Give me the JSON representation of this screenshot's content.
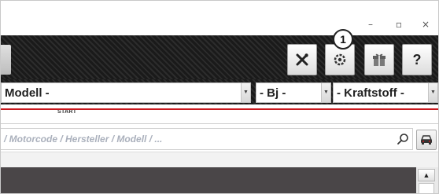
{
  "window": {
    "minimize_glyph": "–",
    "maximize_glyph": "▫",
    "close_glyph": "×"
  },
  "toolbar": {
    "buttons": [
      {
        "name": "tools-button",
        "icon": "wrench-screwdriver-icon"
      },
      {
        "name": "settings-button",
        "icon": "cog-refresh-icon"
      },
      {
        "name": "gift-button",
        "icon": "gift-icon"
      },
      {
        "name": "help-button",
        "icon": "question-icon",
        "label": "?"
      }
    ],
    "callout_number": "1"
  },
  "selectors": {
    "model": "Modell -",
    "year": "- Bj -",
    "fuel": "- Kraftstoff -"
  },
  "tabs": {
    "start_label": "START",
    "accent_color": "#c8191e"
  },
  "search": {
    "placeholder_text": "/ Motorcode / Hersteller / Modell / ..."
  },
  "colors": {
    "toolbar_bg": "#1f1f1f",
    "content_bg": "#4a4648"
  }
}
